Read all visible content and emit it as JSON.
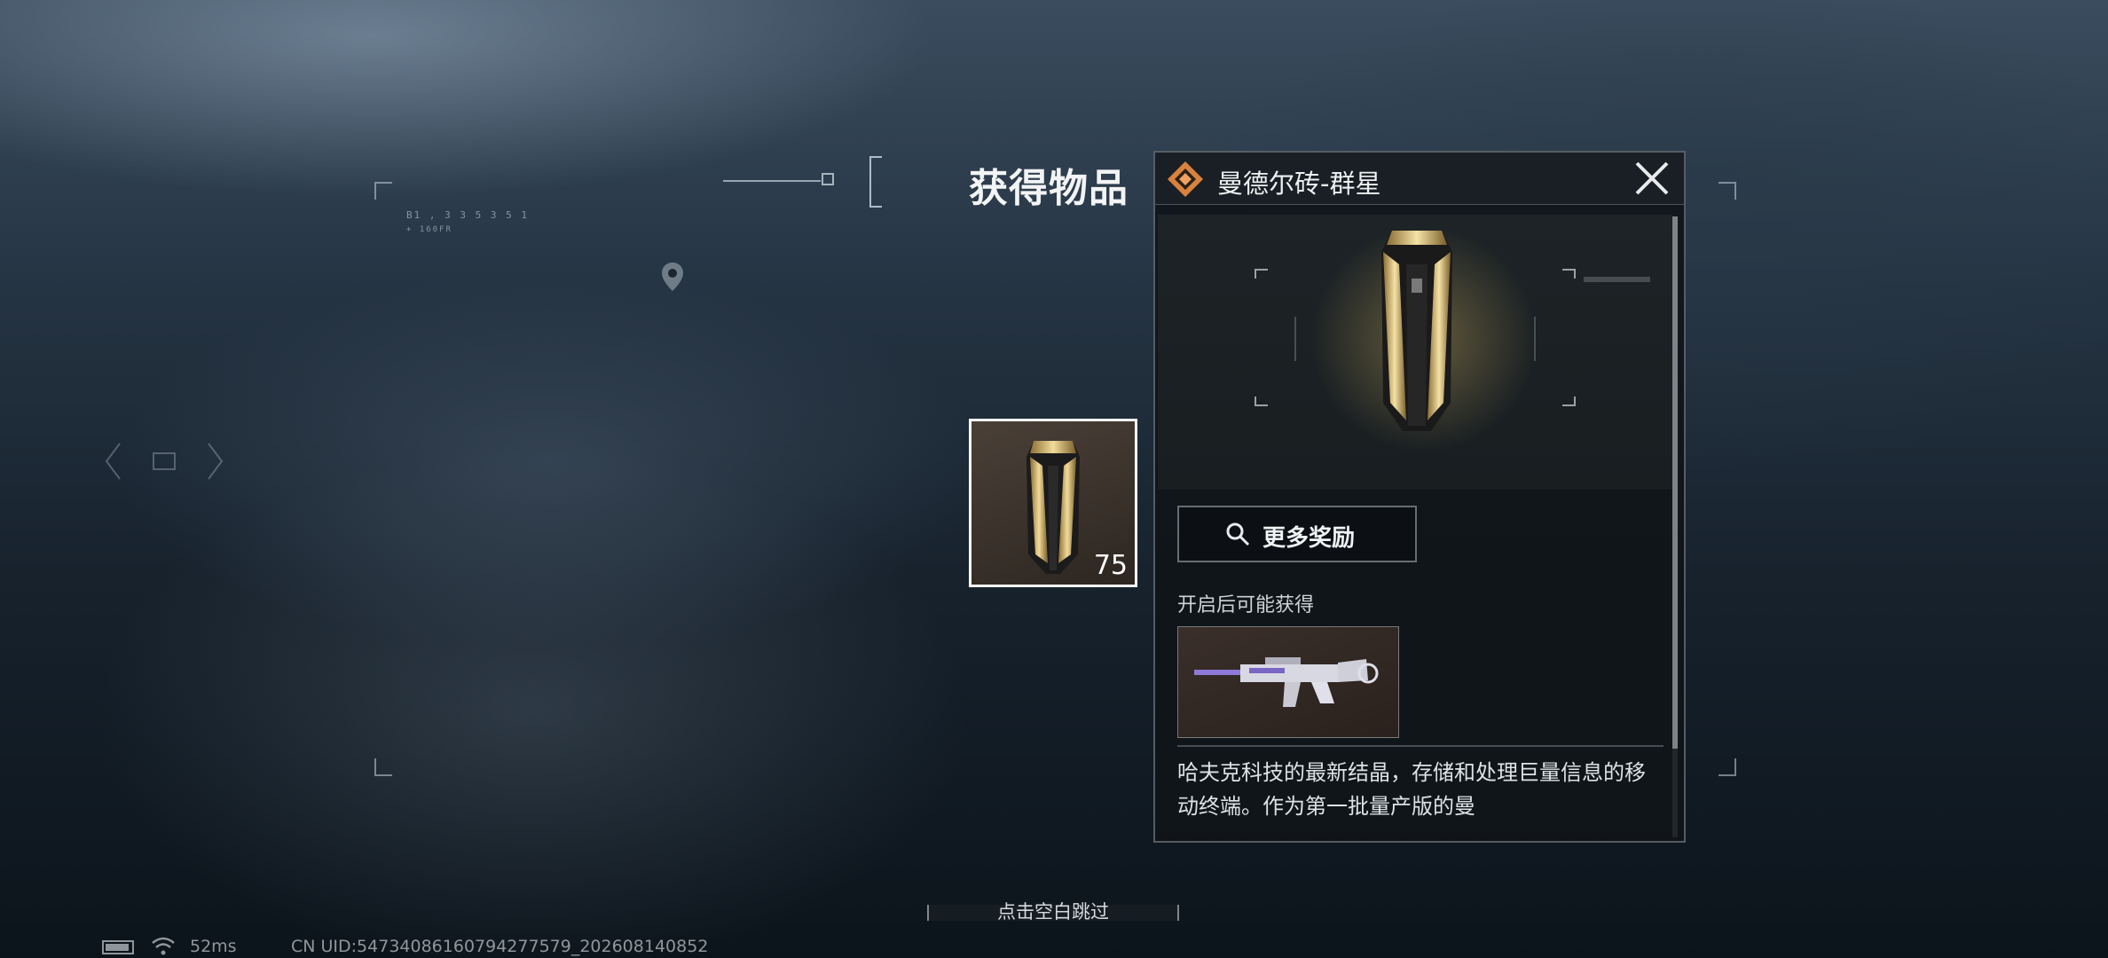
{
  "title": "获得物品",
  "hud": {
    "coords": "B1 , 3 3 5 3 5 1",
    "subcode": "+ 160FR"
  },
  "item_slot": {
    "count": "75"
  },
  "panel": {
    "item_name": "曼德尔砖-群星",
    "more_rewards_label": "更多奖励",
    "reward_caption": "开启后可能获得",
    "description": "哈夫克科技的最新结晶，存储和处理巨量信息的移动终端。作为第一批量产版的曼"
  },
  "skip_hint": "点击空白跳过",
  "status_bar": {
    "ping": "52ms",
    "uid": "CN UID:5473408616079427757​9_202608140852"
  },
  "colors": {
    "rarity_orange": "#d9823e",
    "gold": "#d4b46a",
    "panel_bg": "#101519"
  },
  "icons": [
    "rarity-diamond-icon",
    "close-icon",
    "search-icon",
    "wifi-icon",
    "battery-icon",
    "location-pin-icon"
  ]
}
